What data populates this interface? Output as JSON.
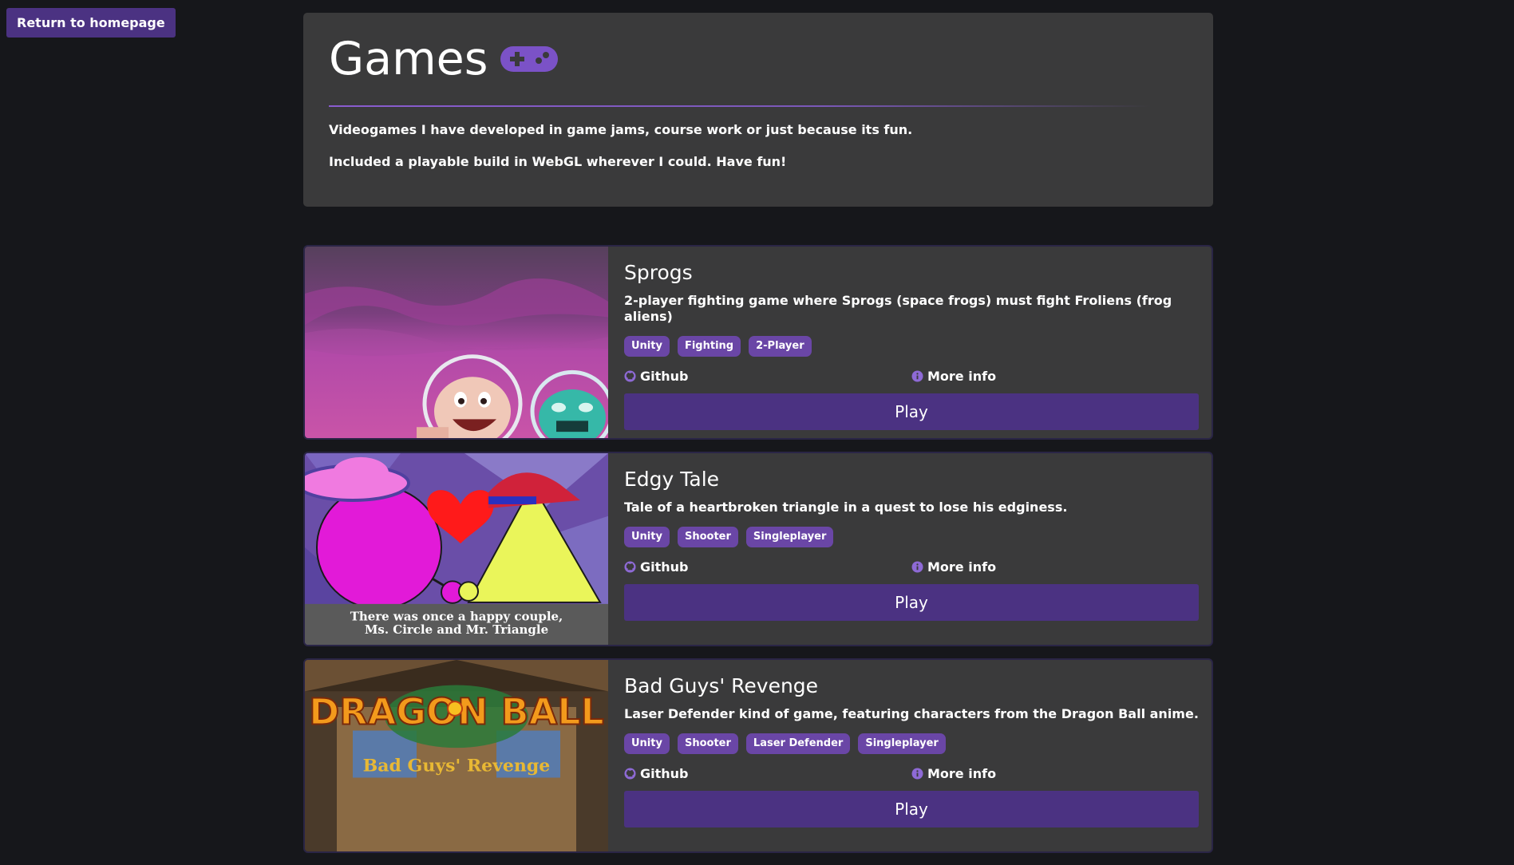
{
  "nav": {
    "return_label": "Return to homepage"
  },
  "header": {
    "title": "Games",
    "icon": "gamepad-icon",
    "intro_1": "Videogames I have developed in game jams, course work or just because its fun.",
    "intro_2": "Included a playable build in WebGL wherever I could. Have fun!"
  },
  "colors": {
    "accent": "#4b3282",
    "tag": "#6a46a6",
    "card": "#3a3a3b",
    "page": "#16171b"
  },
  "games": [
    {
      "title": "Sprogs",
      "description": "2-player fighting game where Sprogs (space frogs) must fight Froliens (frog aliens)",
      "tags": [
        "Unity",
        "Fighting",
        "2-Player"
      ],
      "github_label": "Github",
      "more_info_label": "More info",
      "play_label": "Play"
    },
    {
      "title": "Edgy Tale",
      "description": "Tale of a heartbroken triangle in a quest to lose his edginess.",
      "tags": [
        "Unity",
        "Shooter",
        "Singleplayer"
      ],
      "thumb_caption_1": "There was once a happy couple,",
      "thumb_caption_2": "Ms. Circle and Mr. Triangle",
      "github_label": "Github",
      "more_info_label": "More info",
      "play_label": "Play"
    },
    {
      "title": "Bad Guys' Revenge",
      "description": "Laser Defender kind of game, featuring characters from the Dragon Ball anime.",
      "tags": [
        "Unity",
        "Shooter",
        "Laser Defender",
        "Singleplayer"
      ],
      "thumb_logo": "DRAGON BALL",
      "thumb_subtitle": "Bad Guys' Revenge",
      "github_label": "Github",
      "more_info_label": "More info",
      "play_label": "Play"
    }
  ]
}
